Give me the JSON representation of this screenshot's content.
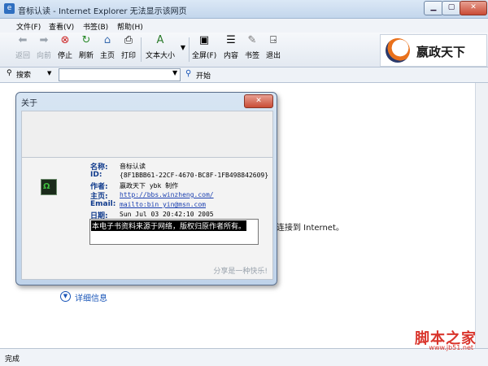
{
  "window": {
    "title": "音标认读 - Internet Explorer 无法显示该网页"
  },
  "menus": [
    "文件(F)",
    "查看(V)",
    "书签(B)",
    "帮助(H)"
  ],
  "toolbar": {
    "back": "返回",
    "forward": "向前",
    "stop": "停止",
    "refresh": "刷新",
    "home": "主页",
    "print": "打印",
    "text_size": "文本大小",
    "fullscreen": "全屏(F)",
    "contents": "内容",
    "bookmark": "书签",
    "exit": "退出"
  },
  "logo": {
    "text": "嬴政天下"
  },
  "search": {
    "label": "搜索",
    "placeholder": "",
    "go": "开始"
  },
  "content": {
    "partial_text": "连接到 Internet。",
    "details": "详细信息"
  },
  "status": {
    "text": "完成"
  },
  "dialog": {
    "title": "关于",
    "close": "✕",
    "fields": [
      {
        "key": "名称:",
        "value": "音标认读",
        "link": false
      },
      {
        "key": "ID:",
        "value": "{8F1BBB61-22CF-4670-BC8F-1FB498842609}",
        "link": false
      },
      {
        "key": "作者:",
        "value": "嬴政天下 ybk 制作",
        "link": false
      },
      {
        "key": "主页:",
        "value": "http://bbs.winzheng.com/",
        "link": true
      },
      {
        "key": "Email:",
        "value": "mailto:bin_yin@msn.com",
        "link": true
      },
      {
        "key": "日期:",
        "value": "Sun Jul 03 20:42:10 2005",
        "link": false
      }
    ],
    "note": "本电子书资料来源于网络，版权归原作者所有。",
    "footer": "分享是一种快乐!"
  },
  "watermark": {
    "main": "脚本之家",
    "url": "www.jb51.net"
  }
}
